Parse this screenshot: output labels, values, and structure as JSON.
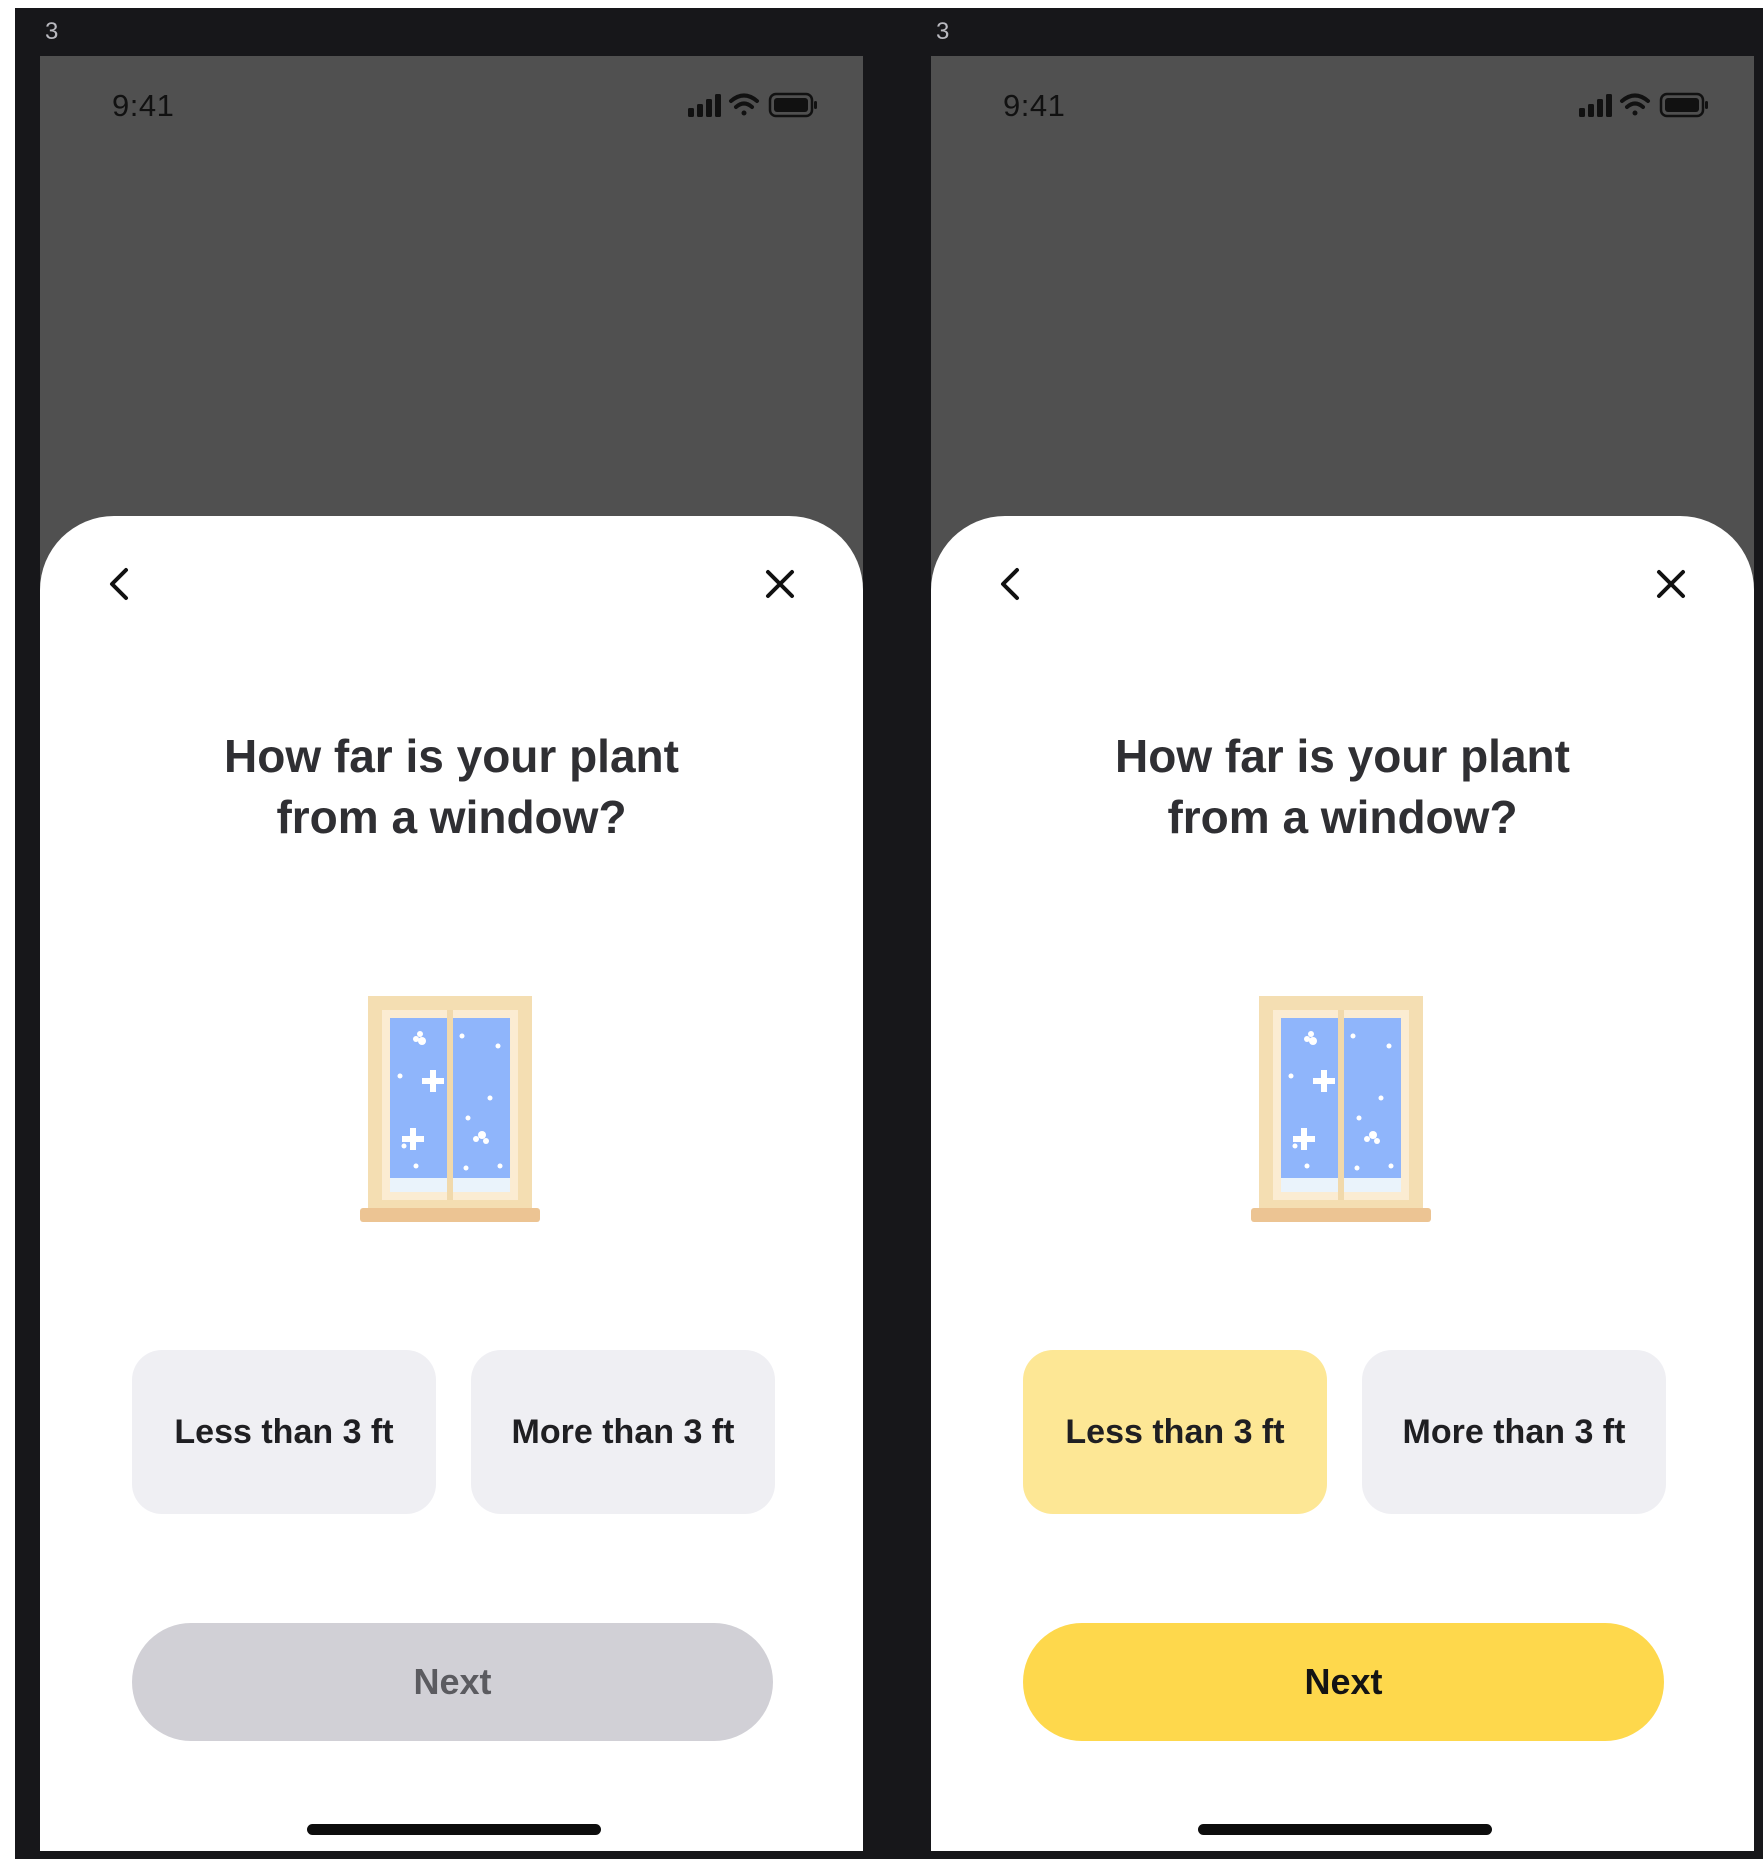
{
  "frames": [
    {
      "frame_label": "3",
      "status_time": "9:41",
      "title_line1": "How far is your plant",
      "title_line2": "from a window?",
      "option_less": "Less than 3 ft",
      "option_more": "More than 3 ft",
      "next_label": "Next",
      "selected_option": null,
      "next_enabled": false
    },
    {
      "frame_label": "3",
      "status_time": "9:41",
      "title_line1": "How far is your plant",
      "title_line2": "from a window?",
      "option_less": "Less than 3 ft",
      "option_more": "More than 3 ft",
      "next_label": "Next",
      "selected_option": "Less than 3 ft",
      "next_enabled": true
    }
  ],
  "icons": {
    "back": "chevron-left-icon",
    "close": "close-icon",
    "signal": "cellular-signal-icon",
    "wifi": "wifi-icon",
    "battery": "battery-icon",
    "illustration": "window-illustration"
  },
  "colors": {
    "canvas_bg": "#17171a",
    "backdrop": "#505050",
    "sheet_bg": "#ffffff",
    "option_bg": "#efeff3",
    "option_selected_bg": "#fde795",
    "next_disabled_bg": "#d1d0d6",
    "next_enabled_bg": "#fed84c",
    "window_glass": "#8fb5fb",
    "window_frame": "#f4deb2"
  }
}
